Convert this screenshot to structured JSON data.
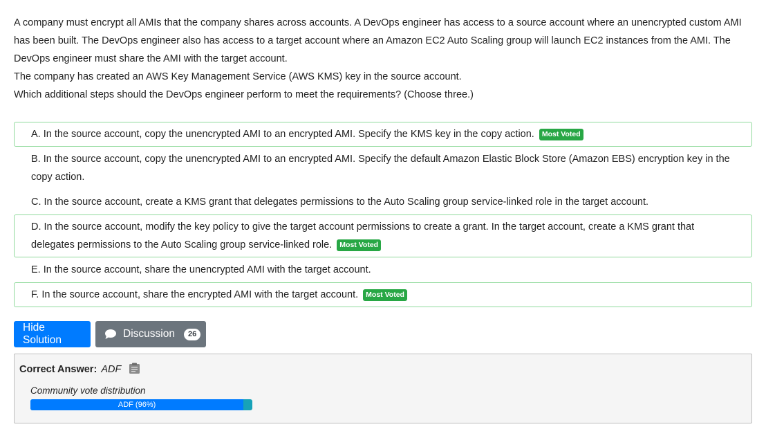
{
  "question": {
    "paragraphs": [
      "A company must encrypt all AMIs that the company shares across accounts. A DevOps engineer has access to a source account where an unencrypted custom AMI has been built. The DevOps engineer also has access to a target account where an Amazon EC2 Auto Scaling group will launch EC2 instances from the AMI. The DevOps engineer must share the AMI with the target account.",
      "The company has created an AWS Key Management Service (AWS KMS) key in the source account.",
      "Which additional steps should the DevOps engineer perform to meet the requirements? (Choose three.)"
    ]
  },
  "choices": [
    {
      "letter": "A.",
      "text": "In the source account, copy the unencrypted AMI to an encrypted AMI. Specify the KMS key in the copy action.",
      "badge": "Most Voted",
      "voted": true
    },
    {
      "letter": "B.",
      "text": "In the source account, copy the unencrypted AMI to an encrypted AMI. Specify the default Amazon Elastic Block Store (Amazon EBS) encryption key in the copy action.",
      "badge": "",
      "voted": false
    },
    {
      "letter": "C.",
      "text": "In the source account, create a KMS grant that delegates permissions to the Auto Scaling group service-linked role in the target account.",
      "badge": "",
      "voted": false
    },
    {
      "letter": "D.",
      "text": "In the source account, modify the key policy to give the target account permissions to create a grant. In the target account, create a KMS grant that delegates permissions to the Auto Scaling group service-linked role.",
      "badge": "Most Voted",
      "voted": true
    },
    {
      "letter": "E.",
      "text": "In the source account, share the unencrypted AMI with the target account.",
      "badge": "",
      "voted": false
    },
    {
      "letter": "F.",
      "text": "In the source account, share the encrypted AMI with the target account.",
      "badge": "Most Voted",
      "voted": true
    }
  ],
  "buttons": {
    "hide_solution": "Hide Solution",
    "discussion": "Discussion",
    "discussion_count": "26"
  },
  "answer": {
    "label": "Correct Answer:",
    "value": "ADF",
    "vote_title": "Community vote distribution",
    "vote_label": "ADF (96%)",
    "vote_percent": 96
  },
  "colors": {
    "primary": "#007bff",
    "secondary": "#6c757d",
    "most_voted": "#28a745",
    "voted_border": "#8fd99b",
    "vote_remainder": "#17a2b8"
  },
  "icons": {
    "discussion": "chat-bubble-icon",
    "reveal": "clipboard-icon"
  }
}
